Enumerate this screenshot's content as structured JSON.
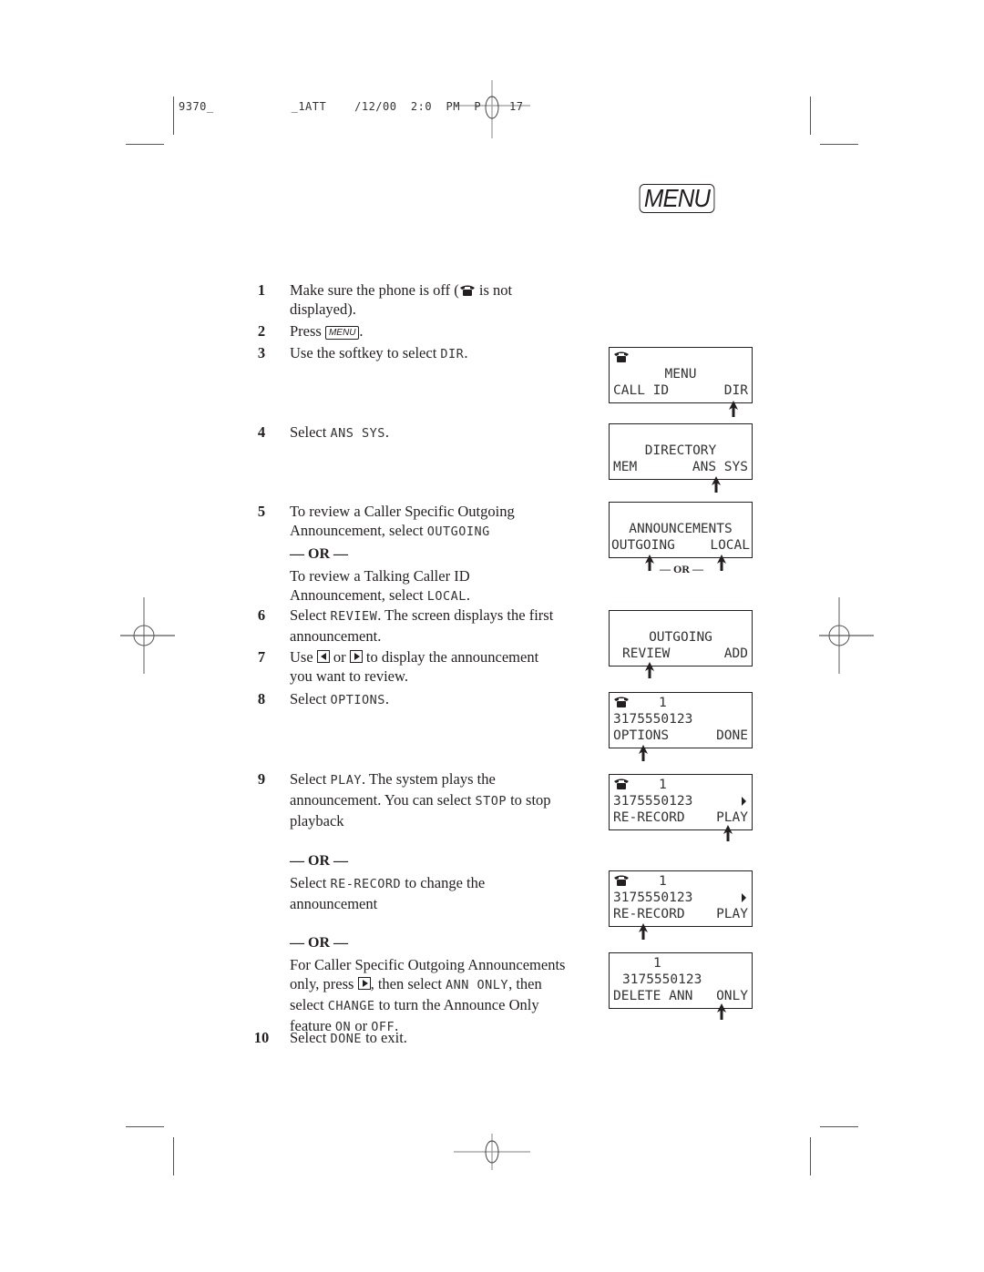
{
  "slug_line": "9370_           _1ATT    /12/00  2:0  PM  P    17",
  "menu_key_label": "MENU",
  "steps": [
    {
      "num": "1",
      "text_a": "Make sure the phone is off (",
      "text_b": " is not displayed)."
    },
    {
      "num": "2",
      "text_a": "Press ",
      "key": "MENU",
      "text_b": "."
    },
    {
      "num": "3",
      "text_a": "Use the softkey to select ",
      "code": "DIR",
      "text_b": "."
    },
    {
      "num": "4",
      "text_a": "Select ",
      "code": "ANS SYS",
      "text_b": "."
    },
    {
      "num": "5",
      "text_a": "To review a Caller Specific Outgoing Announcement, select ",
      "code": "OUTGOING",
      "or": "— OR —",
      "text_c": "To review a Talking Caller ID Announcement, select ",
      "code2": "LOCAL",
      "text_d": "."
    },
    {
      "num": "6",
      "text_a": "Select ",
      "code": "REVIEW",
      "text_b": ". The screen displays the first announcement."
    },
    {
      "num": "7",
      "text_a": "Use ",
      "mid": " or ",
      "text_b": " to display the announcement you want to review."
    },
    {
      "num": "8",
      "text_a": "Select ",
      "code": "OPTIONS",
      "text_b": "."
    },
    {
      "num": "9",
      "text_a": "Select ",
      "code": "PLAY",
      "text_b": ". The system plays the announcement. You can select ",
      "code2": "STOP",
      "text_c": " to stop playback",
      "or1": "— OR —",
      "alt1_a": "Select ",
      "alt1_code": "RE-RECORD",
      "alt1_b": " to change the announcement",
      "or2": "— OR —",
      "alt2_a": "For Caller Specific Outgoing Announcements only, press ",
      "alt2_b": ", then select ",
      "alt2_code1": "ANN ONLY",
      "alt2_c": ", then select ",
      "alt2_code2": "CHANGE",
      "alt2_d": " to turn the Announce Only feature ",
      "alt2_code3": "ON",
      "alt2_e": " or ",
      "alt2_code4": "OFF",
      "alt2_f": "."
    },
    {
      "num": "10",
      "text_a": "Select ",
      "code": "DONE",
      "text_b": " to exit."
    }
  ],
  "screens": [
    {
      "row1": "",
      "row2": "MENU",
      "left": "CALL ID",
      "right": "DIR"
    },
    {
      "row1": "",
      "row2": "DIRECTORY",
      "left": "MEM",
      "right": "ANS SYS"
    },
    {
      "row1": "",
      "row2": "ANNOUNCEMENTS",
      "left": "OUTGOING",
      "right": "LOCAL",
      "or_label": "— OR —"
    },
    {
      "row1": "",
      "row2": "OUTGOING",
      "left": "REVIEW",
      "right": "ADD"
    },
    {
      "row1": "1",
      "row2": "3175550123",
      "left": "OPTIONS",
      "right": "DONE"
    },
    {
      "row1": "1",
      "row2": "3175550123",
      "left": "RE-RECORD",
      "right": "PLAY"
    },
    {
      "row1": "1",
      "row2": "3175550123",
      "left": "RE-RECORD",
      "right": "PLAY"
    },
    {
      "row1": "1",
      "row2": "3175550123",
      "left": "DELETE ANN",
      "right": "ONLY"
    }
  ],
  "icons": {
    "phone": "phone-off-hook-icon",
    "left_arrow": "left-arrow-key-icon",
    "right_arrow": "right-arrow-key-icon",
    "scroll_right": "scroll-right-indicator-icon",
    "softkey_pointer": "softkey-pointer-arrow-icon"
  }
}
